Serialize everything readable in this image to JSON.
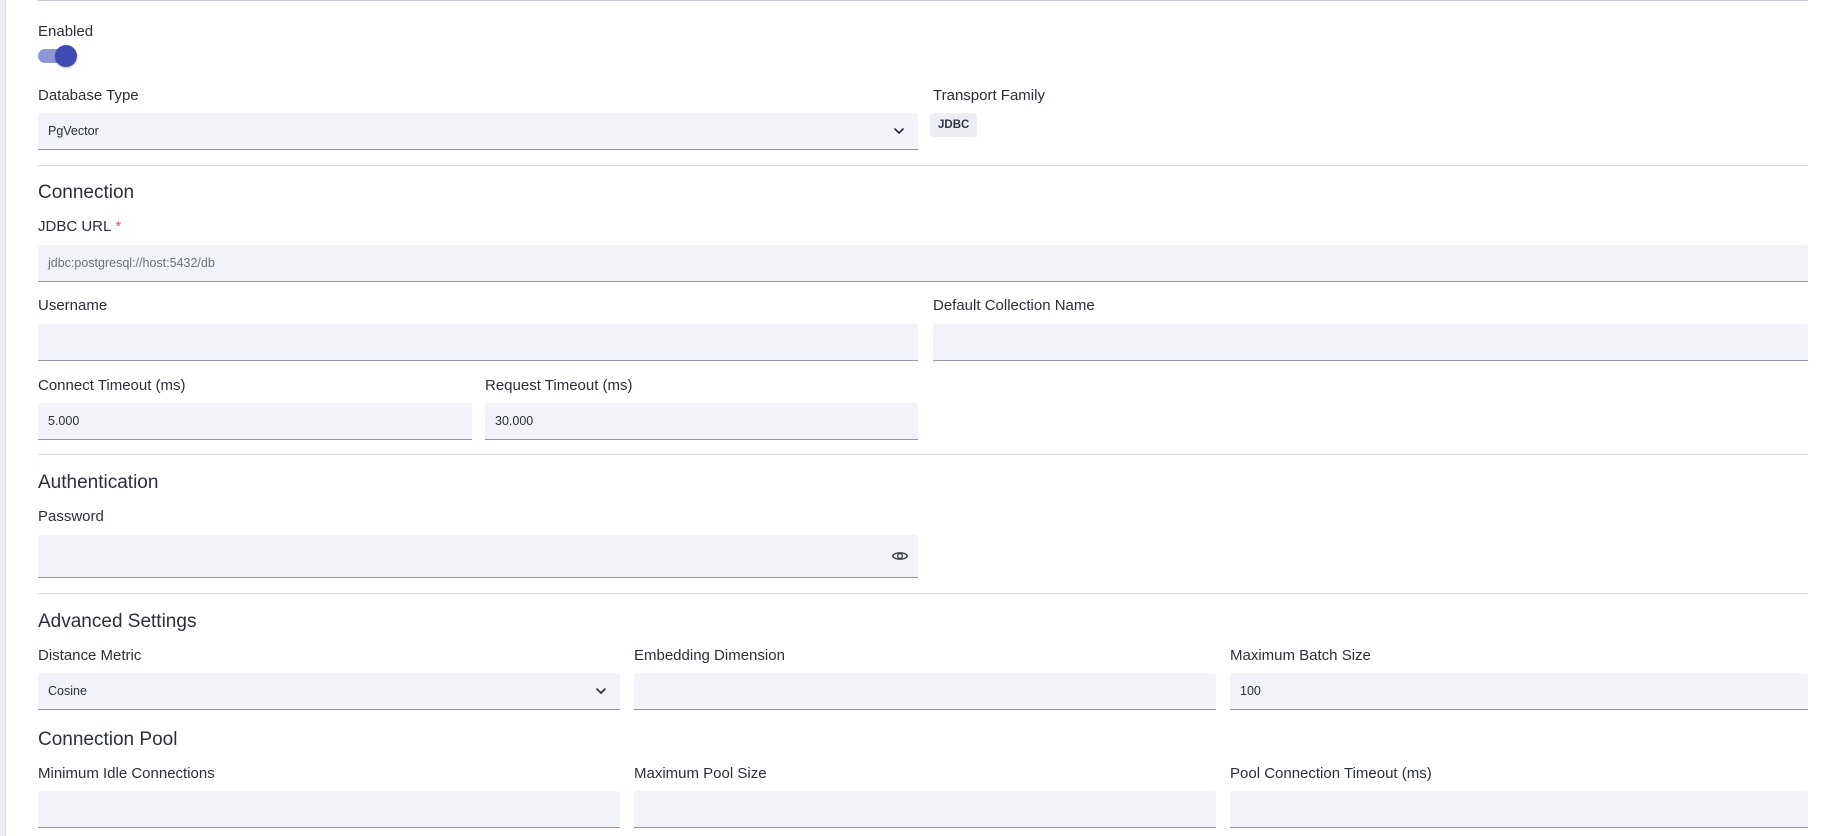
{
  "general": {
    "enabled_label": "Enabled",
    "enabled": true,
    "database_type_label": "Database Type",
    "database_type_value": "PgVector",
    "transport_family_label": "Transport Family",
    "transport_family_value": "JDBC"
  },
  "connection": {
    "title": "Connection",
    "jdbc_url_label": "JDBC URL",
    "required_mark": "*",
    "jdbc_url_placeholder": "jdbc:postgresql://host:5432/db",
    "username_label": "Username",
    "username_value": "",
    "default_collection_label": "Default Collection Name",
    "default_collection_value": "",
    "connect_timeout_label": "Connect Timeout (ms)",
    "connect_timeout_value": "5.000",
    "request_timeout_label": "Request Timeout (ms)",
    "request_timeout_value": "30.000"
  },
  "authentication": {
    "title": "Authentication",
    "password_label": "Password",
    "password_value": "",
    "visibility_icon": "eye-icon"
  },
  "advanced": {
    "title": "Advanced Settings",
    "distance_metric_label": "Distance Metric",
    "distance_metric_value": "Cosine",
    "embedding_dimension_label": "Embedding Dimension",
    "embedding_dimension_value": "",
    "max_batch_label": "Maximum Batch Size",
    "max_batch_value": "100"
  },
  "pool": {
    "title": "Connection Pool",
    "min_idle_label": "Minimum Idle Connections",
    "min_idle_value": "",
    "max_pool_label": "Maximum Pool Size",
    "max_pool_value": "",
    "pool_timeout_label": "Pool Connection Timeout (ms)",
    "pool_timeout_value": ""
  },
  "colors": {
    "accent": "#3f4ab3",
    "field_bg": "#f1f3f8",
    "required": "#e25563"
  }
}
